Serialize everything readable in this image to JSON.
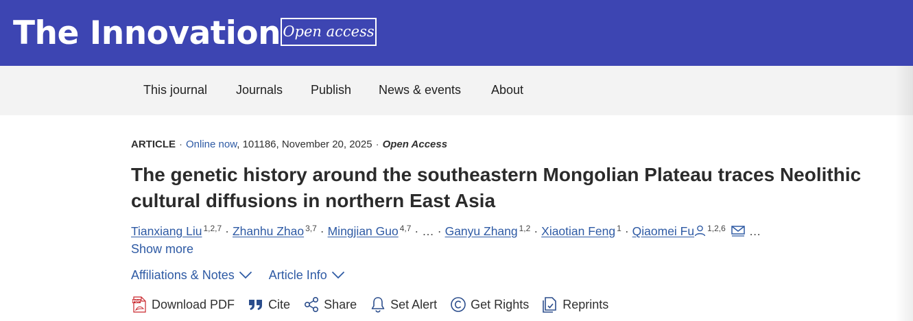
{
  "header": {
    "journal_title": "The Innovation",
    "open_access_badge": "Open access",
    "background_color": "#3d45b2"
  },
  "nav": {
    "items": [
      "This journal",
      "Journals",
      "Publish",
      "News & events",
      "About"
    ]
  },
  "article": {
    "type": "ARTICLE",
    "online_now": "Online now",
    "citation": "101186, November 20, 2025",
    "access": "Open Access",
    "title": "The genetic history around the southeastern Mongolian Plateau traces Neolithic cultural diffusions in northern East Asia",
    "authors": [
      {
        "name": "Tianxiang Liu",
        "affiliations": "1,2,7"
      },
      {
        "name": "Zhanhu Zhao",
        "affiliations": "3,7"
      },
      {
        "name": "Mingjian Guo",
        "affiliations": "4,7"
      },
      {
        "name": "Ganyu Zhang",
        "affiliations": "1,2"
      },
      {
        "name": "Xiaotian Feng",
        "affiliations": "1"
      },
      {
        "name": "Qiaomei Fu",
        "affiliations": "1,2,6"
      }
    ],
    "ellipsis": "…",
    "show_more": "Show more",
    "toggles": [
      "Affiliations & Notes",
      "Article Info"
    ],
    "actions": [
      {
        "label": "Download PDF",
        "icon": "pdf-icon"
      },
      {
        "label": "Cite",
        "icon": "quote-icon"
      },
      {
        "label": "Share",
        "icon": "share-icon"
      },
      {
        "label": "Set Alert",
        "icon": "bell-icon"
      },
      {
        "label": "Get Rights",
        "icon": "copyright-icon"
      },
      {
        "label": "Reprints",
        "icon": "reprints-icon"
      }
    ]
  },
  "colors": {
    "link": "#2e5aa4",
    "nav_background": "#f3f3f3"
  }
}
